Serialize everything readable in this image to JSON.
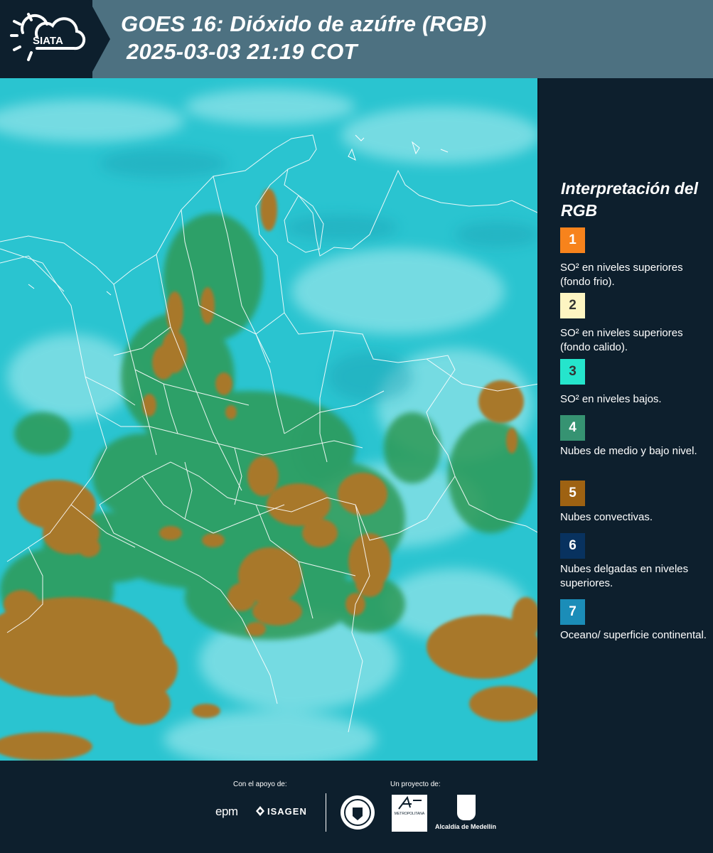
{
  "header": {
    "logo_text": "SIATA",
    "title_line1": "GOES 16: Dióxido de azúfre (RGB)",
    "title_line2": "2025-03-03 21:19 COT"
  },
  "legend": {
    "title": "Interpretación del RGB",
    "items": [
      {
        "number": "1",
        "color": "#f7831c",
        "number_color": "#ffffff",
        "text": "SO² en niveles superiores (fondo frio)."
      },
      {
        "number": "2",
        "color": "#fdf5c2",
        "number_color": "#333333",
        "text": "SO² en niveles superiores (fondo calido)."
      },
      {
        "number": "3",
        "color": "#25e5cc",
        "number_color": "#333333",
        "text": "SO² en niveles bajos."
      },
      {
        "number": "4",
        "color": "#369372",
        "number_color": "#ffffff",
        "text": "Nubes de medio y bajo nivel."
      },
      {
        "number": "5",
        "color": "#9e6212",
        "number_color": "#ffffff",
        "text": "Nubes convectivas."
      },
      {
        "number": "6",
        "color": "#08325f",
        "number_color": "#ffffff",
        "text": "Nubes delgadas en niveles superiores."
      },
      {
        "number": "7",
        "color": "#1b8db8",
        "number_color": "#ffffff",
        "text": "Oceano/ superficie continental."
      }
    ]
  },
  "footer": {
    "support_label": "Con el apoyo de:",
    "project_label": "Un proyecto de:",
    "epm": "epm",
    "isagen": "ISAGEN",
    "area_text": "METROPOLITANA",
    "alcaldia": "Alcaldía de Medellín"
  },
  "map_colors": {
    "background": "#29c6d2",
    "convective_cloud": "#a8782a",
    "mid_low_cloud": "#2e9a56",
    "high_thin": "#a9ecef",
    "borders": "#ffffff"
  }
}
